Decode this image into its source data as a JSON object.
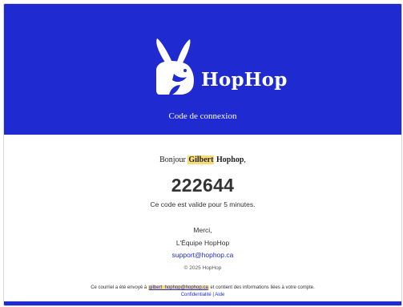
{
  "header": {
    "brand": "HopHop",
    "subtitle": "Code de connexion"
  },
  "body": {
    "greeting_prefix": "Bonjour ",
    "first_name": "Gilbert",
    "last_name": "Hophop",
    "greeting_suffix": ",",
    "code": "222644",
    "validity": "Ce code est valide pour 5 minutes.",
    "thanks": "Merci,",
    "team": "L'Équipe HopHop",
    "support_email": "support@hophop.ca",
    "copyright": "© 2025 HopHop"
  },
  "footer": {
    "note_prefix": "Ce courriel a été envoyé à ",
    "recipient_email": "gilbert_hophop@hophop.ca",
    "note_suffix": " et contient des informations liées à votre compte.",
    "privacy_link": "Confidentialité",
    "separator": " | ",
    "help_link": "Aide"
  },
  "colors": {
    "brand_blue": "#1f2ad1",
    "highlight": "#f7dd7a"
  },
  "icons": {
    "logo": "rabbit-logo-icon"
  }
}
